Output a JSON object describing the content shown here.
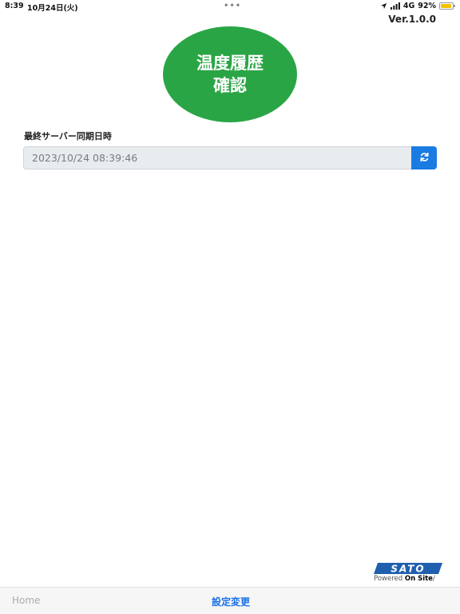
{
  "status_bar": {
    "time": "8:39",
    "date": "10月24日(火)",
    "dots": "•••",
    "network": "4G",
    "battery": "92%",
    "battery_level": 0.92,
    "icons": [
      "location-icon",
      "signal-icon",
      "battery-icon"
    ]
  },
  "header": {
    "version": "Ver.1.0.0"
  },
  "main_button": {
    "line1": "温度履歴",
    "line2": "確認",
    "color": "#2aa545"
  },
  "sync": {
    "label": "最終サーバー同期日時",
    "value": "2023/10/24 08:39:46",
    "refresh_icon": "refresh-icon",
    "refresh_color": "#1a7be3"
  },
  "logo": {
    "brand": "SATO",
    "tagline_prefix": "Powered ",
    "tagline_bold": "On Site",
    "tagline_suffix": "/"
  },
  "tab_bar": {
    "home": "Home",
    "settings": "設定変更",
    "active_color": "#1a73e8"
  }
}
